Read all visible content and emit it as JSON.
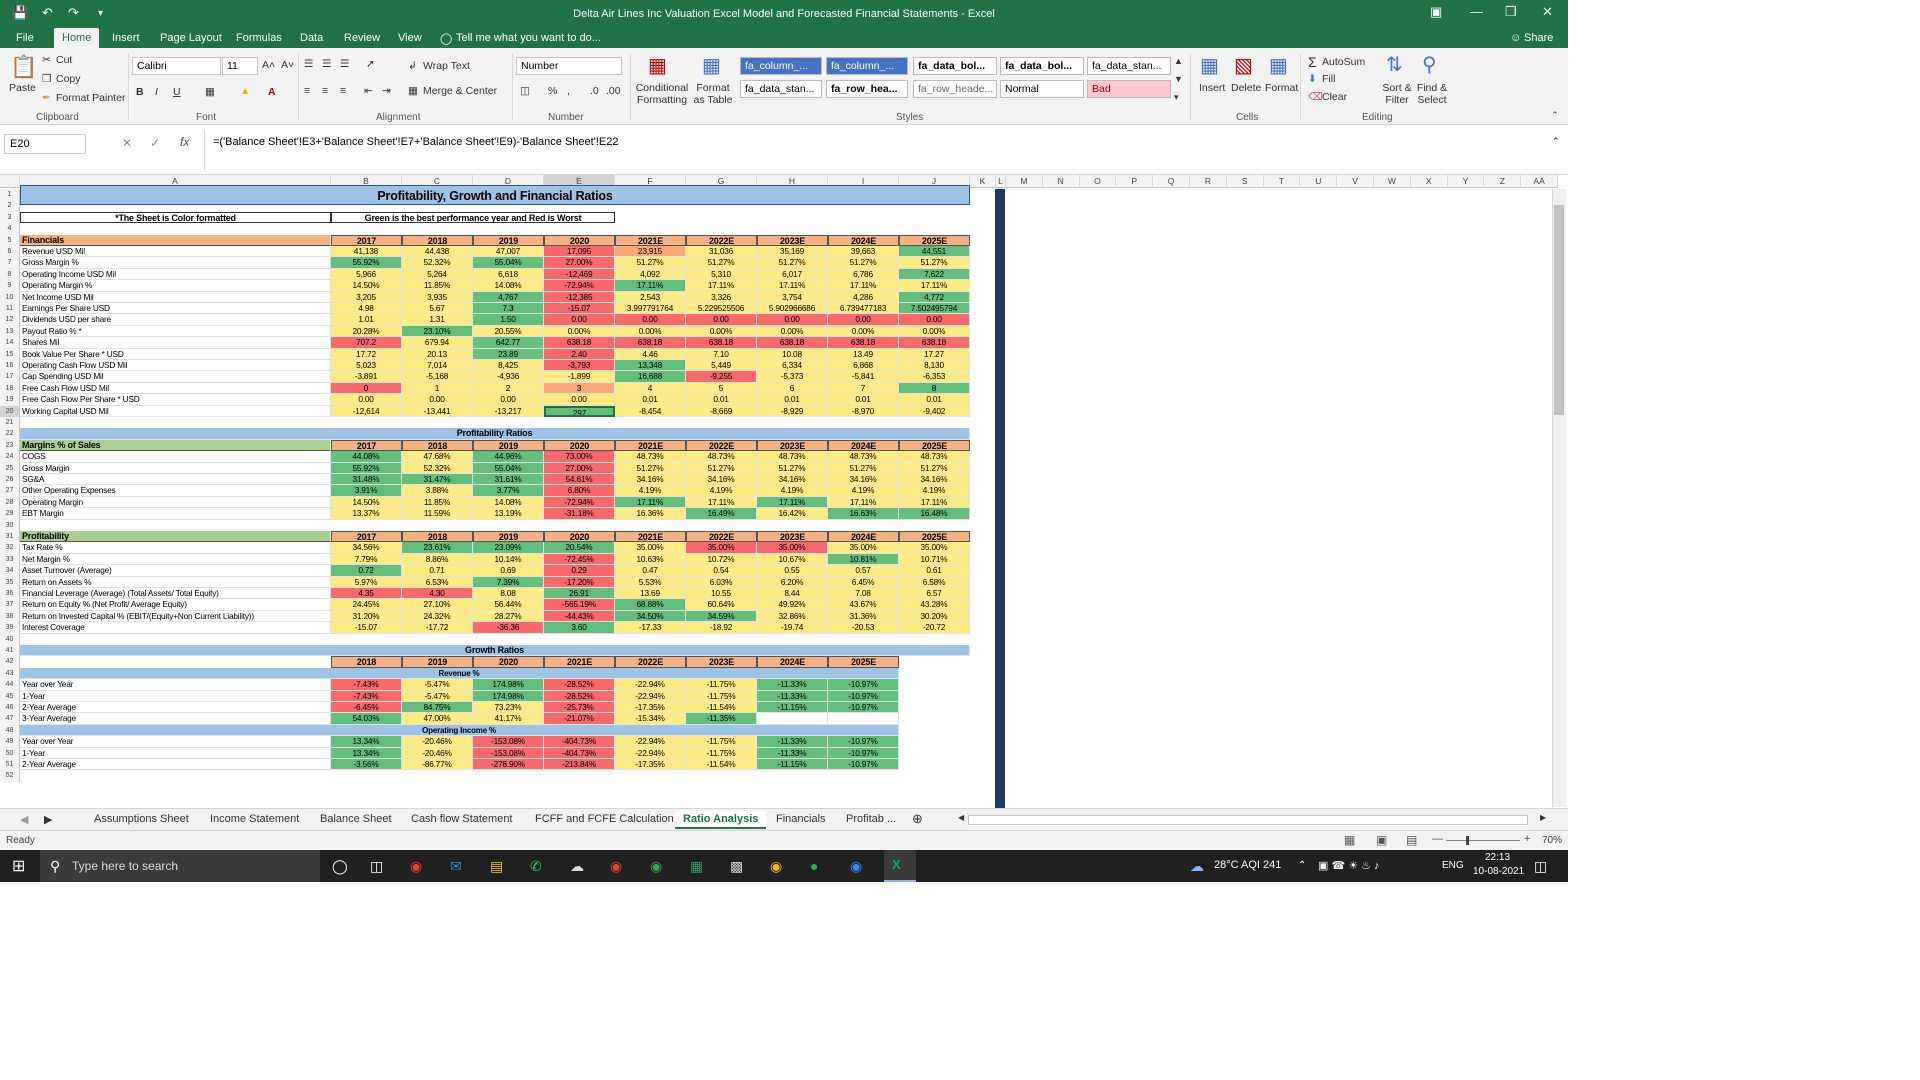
{
  "window": {
    "title": "Delta Air Lines Inc Valuation Excel Model and Forecasted Financial Statements  -  Excel"
  },
  "menu": {
    "tabs": [
      "File",
      "Home",
      "Insert",
      "Page Layout",
      "Formulas",
      "Data",
      "Review",
      "View"
    ],
    "active": "Home",
    "tell_me": "Tell me what you want to do...",
    "share": "Share"
  },
  "ribbon": {
    "paste": "Paste",
    "cut": "Cut",
    "copy": "Copy",
    "format_painter": "Format Painter",
    "clipboard": "Clipboard",
    "font_name": "Calibri",
    "font_size": "11",
    "font": "Font",
    "wrap_text": "Wrap Text",
    "merge_center": "Merge & Center",
    "alignment": "Alignment",
    "number_format": "Number",
    "number": "Number",
    "conditional_formatting": "Conditional Formatting",
    "format_as_table": "Format as Table",
    "styles_row1": [
      "fa_column_...",
      "fa_column_...",
      "fa_data_bol...",
      "fa_data_bol...",
      "fa_data_stan..."
    ],
    "styles_row2": [
      "fa_data_stan...",
      "fa_row_hea...",
      "fa_row_heade...",
      "Normal",
      "Bad"
    ],
    "styles": "Styles",
    "insert": "Insert",
    "delete": "Delete",
    "format": "Format",
    "cells": "Cells",
    "autosum": "AutoSum",
    "fill": "Fill",
    "clear": "Clear",
    "sort_filter": "Sort & Filter",
    "find_select": "Find & Select",
    "editing": "Editing"
  },
  "formula_bar": {
    "name_box": "E20",
    "formula": "=('Balance Sheet'!E3+'Balance Sheet'!E7+'Balance Sheet'!E9)-'Balance Sheet'!E22"
  },
  "columns": [
    "A",
    "B",
    "C",
    "D",
    "E",
    "F",
    "G",
    "H",
    "I",
    "J",
    "K",
    "L",
    "M",
    "N",
    "O",
    "P",
    "Q",
    "R",
    "S",
    "T",
    "U",
    "V",
    "W",
    "X",
    "Y",
    "Z",
    "AA"
  ],
  "sheet": {
    "title": "Profitability, Growth and Financial Ratios",
    "note": "*The Sheet is Color formatted",
    "legend": "Green is the best performance year and Red is Worst",
    "years": [
      "2017",
      "2018",
      "2019",
      "2020",
      "2021E",
      "2022E",
      "2023E",
      "2024E",
      "2025E"
    ],
    "fin_header": "Financials",
    "financials": [
      {
        "label": "Revenue USD Mil",
        "v": [
          "41,138",
          "44,438",
          "47,007",
          "17,095",
          "23,915",
          "31,036",
          "35,169",
          "39,663",
          "44,551"
        ],
        "c": [
          "y",
          "y",
          "y",
          "r",
          "o",
          "y",
          "y",
          "y",
          "g"
        ]
      },
      {
        "label": "Gross Margin %",
        "v": [
          "55.92%",
          "52.32%",
          "55.04%",
          "27.00%",
          "51.27%",
          "51.27%",
          "51.27%",
          "51.27%",
          "51.27%"
        ],
        "c": [
          "g",
          "y",
          "g",
          "r",
          "y",
          "y",
          "y",
          "y",
          "y"
        ]
      },
      {
        "label": "Operating Income USD Mil",
        "v": [
          "5,966",
          "5,264",
          "6,618",
          "-12,469",
          "4,092",
          "5,310",
          "6,017",
          "6,786",
          "7,622"
        ],
        "c": [
          "y",
          "y",
          "y",
          "r",
          "y",
          "y",
          "y",
          "y",
          "g"
        ]
      },
      {
        "label": "Operating Margin %",
        "v": [
          "14.50%",
          "11.85%",
          "14.08%",
          "-72.94%",
          "17.11%",
          "17.11%",
          "17.11%",
          "17.11%",
          "17.11%"
        ],
        "c": [
          "y",
          "y",
          "y",
          "r",
          "g",
          "y",
          "y",
          "y",
          "y"
        ]
      },
      {
        "label": "Net Income USD Mil",
        "v": [
          "3,205",
          "3,935",
          "4,767",
          "-12,385",
          "2,543",
          "3,326",
          "3,754",
          "4,286",
          "4,772"
        ],
        "c": [
          "y",
          "y",
          "g",
          "r",
          "y",
          "y",
          "y",
          "y",
          "g"
        ]
      },
      {
        "label": "Earnings Per Share USD",
        "v": [
          "4.98",
          "5.67",
          "7.3",
          "-15.07",
          "3.997791764",
          "5.229525506",
          "5.902966686",
          "6.739477183",
          "7.502495794"
        ],
        "c": [
          "y",
          "y",
          "g",
          "r",
          "y",
          "y",
          "y",
          "y",
          "g"
        ]
      },
      {
        "label": "Dividends USD per share",
        "v": [
          "1.01",
          "1.31",
          "1.50",
          "0.00",
          "0.00",
          "0.00",
          "0.00",
          "0.00",
          "0.00"
        ],
        "c": [
          "y",
          "y",
          "g",
          "r",
          "r",
          "r",
          "r",
          "r",
          "r"
        ]
      },
      {
        "label": "Payout Ratio % *",
        "v": [
          "20.28%",
          "23.10%",
          "20.55%",
          "0.00%",
          "0.00%",
          "0.00%",
          "0.00%",
          "0.00%",
          "0.00%"
        ],
        "c": [
          "y",
          "g",
          "y",
          "y",
          "y",
          "y",
          "y",
          "y",
          "y"
        ]
      },
      {
        "label": "Shares Mil",
        "v": [
          "707.2",
          "679.94",
          "642.77",
          "638.18",
          "638.18",
          "638.18",
          "638.18",
          "638.18",
          "638.18"
        ],
        "c": [
          "r",
          "y",
          "g",
          "r",
          "r",
          "r",
          "r",
          "r",
          "r"
        ]
      },
      {
        "label": "Book Value Per Share * USD",
        "v": [
          "17.72",
          "20.13",
          "23.89",
          "2.40",
          "4.46",
          "7.10",
          "10.08",
          "13.49",
          "17.27"
        ],
        "c": [
          "y",
          "y",
          "g",
          "r",
          "y",
          "y",
          "y",
          "y",
          "y"
        ]
      },
      {
        "label": "Operating Cash Flow USD Mil",
        "v": [
          "5,023",
          "7,014",
          "8,425",
          "-3,793",
          "13,348",
          "5,449",
          "6,334",
          "6,868",
          "8,130"
        ],
        "c": [
          "y",
          "y",
          "y",
          "r",
          "g",
          "y",
          "y",
          "y",
          "y"
        ]
      },
      {
        "label": "Cap Spending USD Mil",
        "v": [
          "-3,891",
          "-5,168",
          "-4,936",
          "-1,899",
          "16,688",
          "-9,255",
          "-5,373",
          "-5,841",
          "-6,353"
        ],
        "c": [
          "y",
          "y",
          "y",
          "y",
          "g",
          "r",
          "y",
          "y",
          "y"
        ]
      },
      {
        "label": "Free Cash Flow USD Mil",
        "v": [
          "0",
          "1",
          "2",
          "3",
          "4",
          "5",
          "6",
          "7",
          "8"
        ],
        "c": [
          "r",
          "y",
          "y",
          "o",
          "y",
          "y",
          "y",
          "y",
          "g"
        ]
      },
      {
        "label": "Free Cash Flow Per Share * USD",
        "v": [
          "0.00",
          "0.00",
          "0.00",
          "0.00",
          "0.01",
          "0.01",
          "0.01",
          "0.01",
          "0.01"
        ],
        "c": [
          "y",
          "y",
          "y",
          "y",
          "y",
          "y",
          "y",
          "y",
          "y"
        ]
      },
      {
        "label": "Working Capital USD Mil",
        "v": [
          "-12,614",
          "-13,441",
          "-13,217",
          "297",
          "-8,454",
          "-8,669",
          "-8,929",
          "-8,970",
          "-9,402"
        ],
        "c": [
          "y",
          "y",
          "y",
          "g",
          "y",
          "y",
          "y",
          "y",
          "y"
        ]
      }
    ],
    "prof_title": "Profitability Ratios",
    "margins_header": "Margins % of Sales",
    "margins": [
      {
        "label": "COGS",
        "v": [
          "44.08%",
          "47.68%",
          "44.96%",
          "73.00%",
          "48.73%",
          "48.73%",
          "48.73%",
          "48.73%",
          "48.73%"
        ],
        "c": [
          "g",
          "y",
          "g",
          "r",
          "y",
          "y",
          "y",
          "y",
          "y"
        ]
      },
      {
        "label": "Gross Margin",
        "v": [
          "55.92%",
          "52.32%",
          "55.04%",
          "27.00%",
          "51.27%",
          "51.27%",
          "51.27%",
          "51.27%",
          "51.27%"
        ],
        "c": [
          "g",
          "y",
          "g",
          "r",
          "y",
          "y",
          "y",
          "y",
          "y"
        ]
      },
      {
        "label": "SG&A",
        "v": [
          "31.48%",
          "31.47%",
          "31.61%",
          "54.61%",
          "34.16%",
          "34.16%",
          "34.16%",
          "34.16%",
          "34.16%"
        ],
        "c": [
          "g",
          "g",
          "g",
          "r",
          "y",
          "y",
          "y",
          "y",
          "y"
        ]
      },
      {
        "label": "Other Operating Expenses",
        "v": [
          "3.91%",
          "3.88%",
          "3.77%",
          "6.80%",
          "4.19%",
          "4.19%",
          "4.19%",
          "4.19%",
          "4.19%"
        ],
        "c": [
          "g",
          "y",
          "g",
          "r",
          "y",
          "y",
          "y",
          "y",
          "y"
        ]
      },
      {
        "label": "Operating Margin",
        "v": [
          "14.50%",
          "11.85%",
          "14.08%",
          "-72.94%",
          "17.11%",
          "17.11%",
          "17.11%",
          "17.11%",
          "17.11%"
        ],
        "c": [
          "y",
          "y",
          "y",
          "r",
          "g",
          "y",
          "g",
          "y",
          "y"
        ]
      },
      {
        "label": "EBT Margin",
        "v": [
          "13.37%",
          "11.59%",
          "13.19%",
          "-31.18%",
          "16.36%",
          "16.49%",
          "16.42%",
          "16.63%",
          "16.48%"
        ],
        "c": [
          "y",
          "y",
          "y",
          "r",
          "y",
          "g",
          "y",
          "g",
          "g"
        ]
      }
    ],
    "profitability_header": "Profitability",
    "profitability": [
      {
        "label": "Tax Rate %",
        "v": [
          "34.56%",
          "23.61%",
          "23.09%",
          "20.54%",
          "35.00%",
          "35.00%",
          "35.00%",
          "35.00%",
          "35.00%"
        ],
        "c": [
          "y",
          "g",
          "g",
          "g",
          "y",
          "r",
          "r",
          "y",
          "y"
        ]
      },
      {
        "label": "Net Margin %",
        "v": [
          "7.79%",
          "8.86%",
          "10.14%",
          "-72.45%",
          "10.63%",
          "10.72%",
          "10.67%",
          "10.81%",
          "10.71%"
        ],
        "c": [
          "y",
          "y",
          "y",
          "r",
          "y",
          "y",
          "y",
          "g",
          "y"
        ]
      },
      {
        "label": "Asset Turnover (Average)",
        "v": [
          "0.72",
          "0.71",
          "0.69",
          "0.29",
          "0.47",
          "0.54",
          "0.55",
          "0.57",
          "0.61"
        ],
        "c": [
          "g",
          "y",
          "y",
          "r",
          "y",
          "y",
          "y",
          "y",
          "y"
        ]
      },
      {
        "label": "Return on Assets %",
        "v": [
          "5.97%",
          "6.53%",
          "7.39%",
          "-17.20%",
          "5.53%",
          "6.03%",
          "6.20%",
          "6.45%",
          "6.58%"
        ],
        "c": [
          "y",
          "y",
          "g",
          "r",
          "y",
          "y",
          "y",
          "y",
          "y"
        ]
      },
      {
        "label": "Financial Leverage (Average) (Total Assets/ Total Equity)",
        "v": [
          "4.35",
          "4.30",
          "8.08",
          "26.91",
          "13.69",
          "10.55",
          "8.44",
          "7.08",
          "6.57"
        ],
        "c": [
          "r",
          "r",
          "y",
          "g",
          "y",
          "y",
          "y",
          "y",
          "y"
        ]
      },
      {
        "label": "Return on Equity % (Net Profit/ Average Equity)",
        "v": [
          "24.45%",
          "27.10%",
          "56.44%",
          "-565.19%",
          "68.88%",
          "60.64%",
          "49.92%",
          "43.67%",
          "43.28%"
        ],
        "c": [
          "y",
          "y",
          "y",
          "r",
          "g",
          "y",
          "y",
          "y",
          "y"
        ]
      },
      {
        "label": "Return on Invested Capital % (EBIT/(Equity+Non Current Liability))",
        "v": [
          "31.20%",
          "24.32%",
          "28.27%",
          "-44.43%",
          "34.50%",
          "34.59%",
          "32.86%",
          "31.36%",
          "30.20%"
        ],
        "c": [
          "y",
          "y",
          "y",
          "r",
          "g",
          "g",
          "y",
          "y",
          "y"
        ]
      },
      {
        "label": "Interest Coverage",
        "v": [
          "-15.07",
          "-17.72",
          "-36.36",
          "3.60",
          "-17.33",
          "-18.92",
          "-19.74",
          "-20.53",
          "-20.72"
        ],
        "c": [
          "y",
          "y",
          "r",
          "g",
          "y",
          "y",
          "y",
          "y",
          "y"
        ]
      }
    ],
    "growth_title": "Growth Ratios",
    "growth_years": [
      "2018",
      "2019",
      "2020",
      "2021E",
      "2022E",
      "2023E",
      "2024E",
      "2025E"
    ],
    "revenue_header": "Revenue %",
    "revenue_growth": [
      {
        "label": "Year over Year",
        "v": [
          "-7.43%",
          "-5.47%",
          "174.98%",
          "-28.52%",
          "-22.94%",
          "-11.75%",
          "-11.33%",
          "-10.97%"
        ],
        "c": [
          "r",
          "y",
          "g",
          "r",
          "y",
          "y",
          "g",
          "g"
        ]
      },
      {
        "label": "1-Year",
        "v": [
          "-7.43%",
          "-5.47%",
          "174.98%",
          "-28.52%",
          "-22.94%",
          "-11.75%",
          "-11.33%",
          "-10.97%"
        ],
        "c": [
          "r",
          "y",
          "g",
          "r",
          "y",
          "y",
          "g",
          "g"
        ]
      },
      {
        "label": "2-Year Average",
        "v": [
          "-6.45%",
          "84.75%",
          "73.23%",
          "-25.73%",
          "-17.35%",
          "-11.54%",
          "-11.15%",
          "-10.97%"
        ],
        "c": [
          "r",
          "g",
          "y",
          "r",
          "y",
          "y",
          "g",
          "g"
        ]
      },
      {
        "label": "3-Year Average",
        "v": [
          "54.03%",
          "47.00%",
          "41.17%",
          "-21.07%",
          "-15.34%",
          "-11.35%",
          "",
          ""
        ],
        "c": [
          "g",
          "y",
          "y",
          "r",
          "y",
          "g",
          "w",
          "w"
        ]
      }
    ],
    "opinc_header": "Operating Income %",
    "opinc_growth": [
      {
        "label": "Year over Year",
        "v": [
          "13.34%",
          "-20.46%",
          "-153.08%",
          "-404.73%",
          "-22.94%",
          "-11.75%",
          "-11.33%",
          "-10.97%"
        ],
        "c": [
          "g",
          "y",
          "r",
          "r",
          "y",
          "y",
          "g",
          "g"
        ]
      },
      {
        "label": "1-Year",
        "v": [
          "13.34%",
          "-20.46%",
          "-153.08%",
          "-404.73%",
          "-22.94%",
          "-11.75%",
          "-11.33%",
          "-10.97%"
        ],
        "c": [
          "g",
          "y",
          "r",
          "r",
          "y",
          "y",
          "g",
          "g"
        ]
      },
      {
        "label": "2-Year Average",
        "v": [
          "-3.56%",
          "-86.77%",
          "-278.90%",
          "-213.84%",
          "-17.35%",
          "-11.54%",
          "-11.15%",
          "-10.97%"
        ],
        "c": [
          "g",
          "y",
          "r",
          "r",
          "y",
          "y",
          "g",
          "g"
        ]
      }
    ]
  },
  "sheet_tabs": [
    "Assumptions Sheet",
    "Income Statement",
    "Balance Sheet",
    "Cash flow Statement",
    "FCFF and FCFE Calculation",
    "Ratio Analysis",
    "Financials",
    "Profitab ..."
  ],
  "active_sheet": "Ratio Analysis",
  "status": {
    "ready": "Ready",
    "zoom": "70%"
  },
  "taskbar": {
    "search": "Type here to search",
    "weather": "28°C  AQI 241",
    "lang": "ENG",
    "time": "22:13",
    "date": "10-08-2021"
  },
  "colors": {
    "excel_green": "#217346",
    "good": "#63be7b",
    "mid": "#ffeb84",
    "bad": "#f8696b",
    "orange": "#fbaa77",
    "header_blue": "#9dc3e6",
    "salmon": "#f4b183",
    "green_label": "#a9d08e"
  }
}
